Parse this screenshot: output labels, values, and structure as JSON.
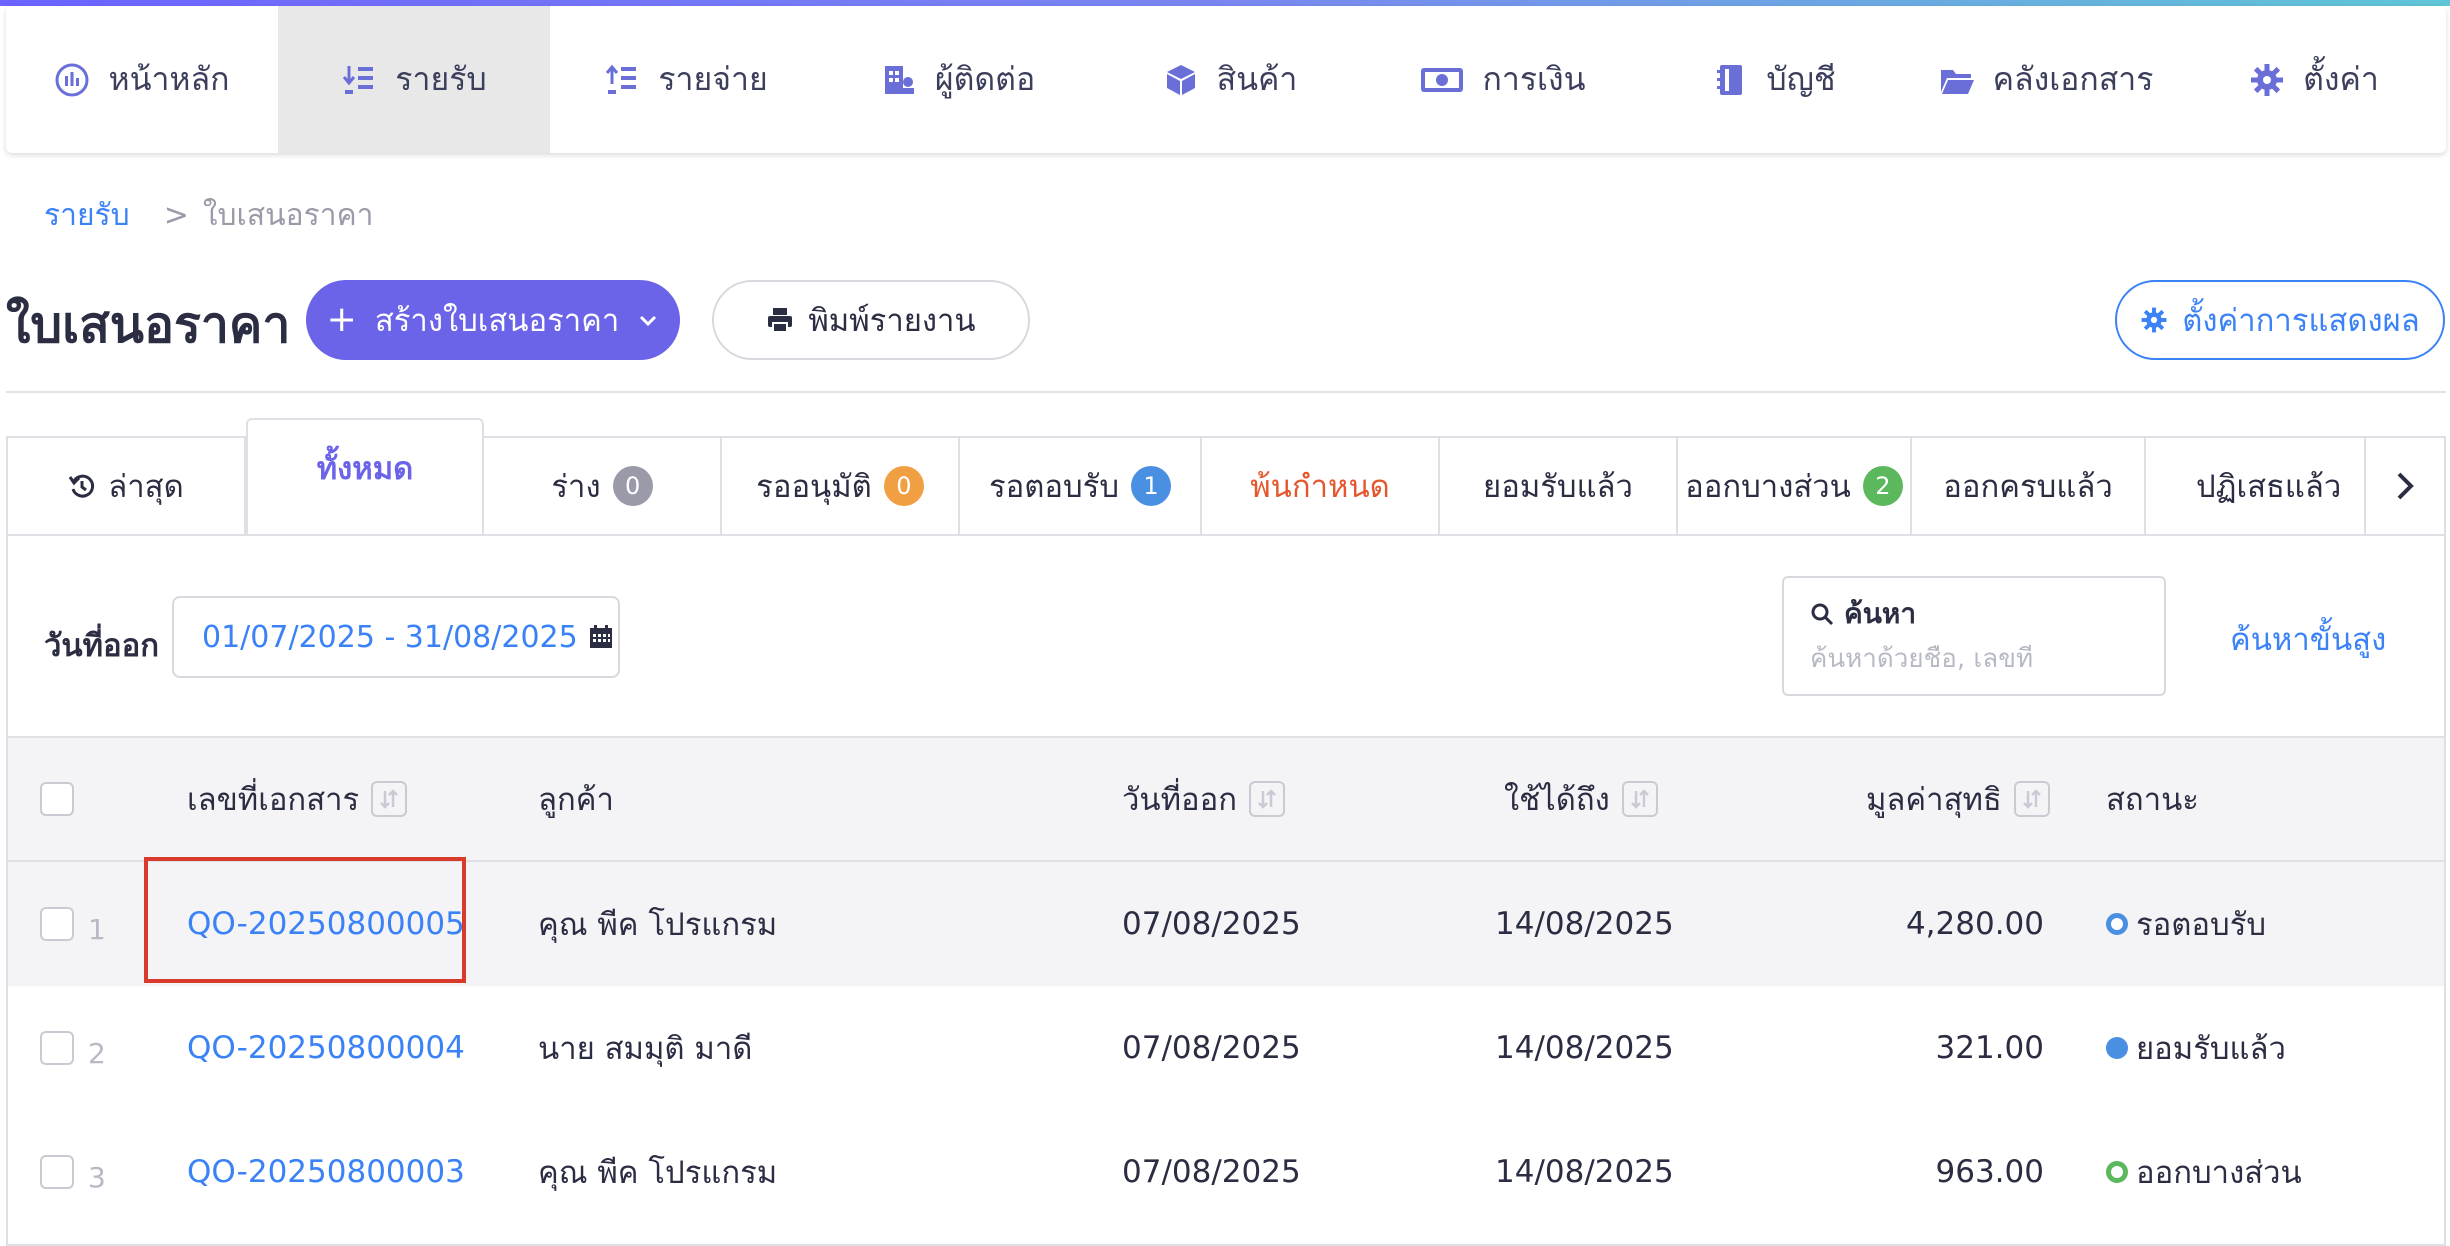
{
  "nav": {
    "items": [
      {
        "label": "หน้าหลัก",
        "icon": "dashboard-icon",
        "active": false
      },
      {
        "label": "รายรับ",
        "icon": "income-list-icon",
        "active": true
      },
      {
        "label": "รายจ่าย",
        "icon": "expense-list-icon",
        "active": false
      },
      {
        "label": "ผู้ติดต่อ",
        "icon": "contacts-icon",
        "active": false
      },
      {
        "label": "สินค้า",
        "icon": "product-box-icon",
        "active": false
      },
      {
        "label": "การเงิน",
        "icon": "money-icon",
        "active": false
      },
      {
        "label": "บัญชี",
        "icon": "ledger-book-icon",
        "active": false
      },
      {
        "label": "คลังเอกสาร",
        "icon": "folder-icon",
        "active": false
      },
      {
        "label": "ตั้งค่า",
        "icon": "gear-icon",
        "active": false
      }
    ]
  },
  "breadcrumb": {
    "parent": "รายรับ",
    "separator": ">",
    "current": "ใบเสนอราคา"
  },
  "header": {
    "title": "ใบเสนอราคา",
    "create_label": "สร้างใบเสนอราคา",
    "print_label": "พิมพ์รายงาน",
    "settings_label": "ตั้งค่าการแสดงผล"
  },
  "tabs": [
    {
      "label": "ล่าสุด",
      "badge": null
    },
    {
      "label": "ทั้งหมด",
      "badge": null,
      "active": true
    },
    {
      "label": "ร่าง",
      "badge": "0",
      "badge_color": "#9a9aa8"
    },
    {
      "label": "รออนุมัติ",
      "badge": "0",
      "badge_color": "#f0a043"
    },
    {
      "label": "รอตอบรับ",
      "badge": "1",
      "badge_color": "#4a90e2"
    },
    {
      "label": "พ้นกำหนด",
      "badge": null,
      "overdue": true
    },
    {
      "label": "ยอมรับแล้ว",
      "badge": null
    },
    {
      "label": "ออกบางส่วน",
      "badge": "2",
      "badge_color": "#5cb85c"
    },
    {
      "label": "ออกครบแล้ว",
      "badge": null
    },
    {
      "label": "ปฏิเสธแล้ว",
      "badge": null
    }
  ],
  "filter": {
    "date_label": "วันที่ออก",
    "date_range": "01/07/2025 - 31/08/2025",
    "search_title": "ค้นหา",
    "search_placeholder": "ค้นหาด้วยชื่อ, เลขที่",
    "advanced_label": "ค้นหาขั้นสูง"
  },
  "table": {
    "columns": {
      "doc_no": "เลขที่เอกสาร",
      "customer": "ลูกค้า",
      "issue_date": "วันที่ออก",
      "valid_until": "ใช้ได้ถึง",
      "net_value": "มูลค่าสุทธิ",
      "status": "สถานะ"
    },
    "rows": [
      {
        "num": "1",
        "doc_no": "QO-20250800005",
        "customer": "คุณ พีค โปรแกรม",
        "issue_date": "07/08/2025",
        "valid_until": "14/08/2025",
        "net_value": "4,280.00",
        "status": "รอตอบรับ",
        "status_style": "ring-blue"
      },
      {
        "num": "2",
        "doc_no": "QO-20250800004",
        "customer": "นาย สมมุติ มาดี",
        "issue_date": "07/08/2025",
        "valid_until": "14/08/2025",
        "net_value": "321.00",
        "status": "ยอมรับแล้ว",
        "status_style": "solid-blue"
      },
      {
        "num": "3",
        "doc_no": "QO-20250800003",
        "customer": "คุณ พีค โปรแกรม",
        "issue_date": "07/08/2025",
        "valid_until": "14/08/2025",
        "net_value": "963.00",
        "status": "ออกบางส่วน",
        "status_style": "ring-green"
      }
    ]
  },
  "colors": {
    "primary": "#6b64e8",
    "link": "#3b82f6",
    "overdue": "#e4572e",
    "highlight": "#d93a2b"
  }
}
